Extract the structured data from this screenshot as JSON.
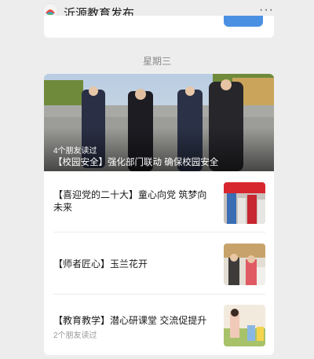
{
  "header": {
    "title": "沂源教育发布",
    "more_label": "···"
  },
  "day_label": "星期三",
  "hero": {
    "read_info": "4个朋友读过",
    "title": "【校园安全】强化部门联动 确保校园安全"
  },
  "articles": [
    {
      "title": "【喜迎党的二十大】童心向党 筑梦向未来",
      "read_info": ""
    },
    {
      "title": "【师者匠心】玉兰花开",
      "read_info": ""
    },
    {
      "title": "【教育教学】潜心研课堂 交流促提升",
      "read_info": "2个朋友读过"
    }
  ]
}
